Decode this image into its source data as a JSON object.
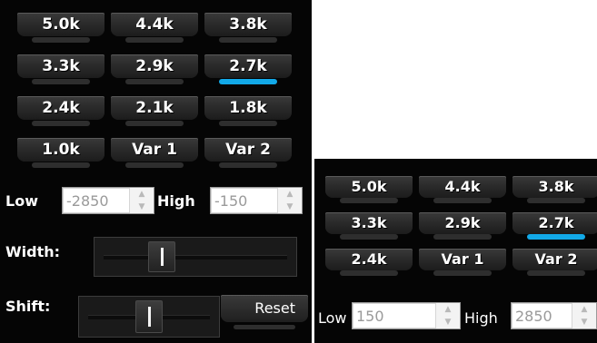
{
  "left": {
    "filters": [
      {
        "label": "5.0k",
        "active": false
      },
      {
        "label": "4.4k",
        "active": false
      },
      {
        "label": "3.8k",
        "active": false
      },
      {
        "label": "3.3k",
        "active": false
      },
      {
        "label": "2.9k",
        "active": false
      },
      {
        "label": "2.7k",
        "active": true
      },
      {
        "label": "2.4k",
        "active": false
      },
      {
        "label": "2.1k",
        "active": false
      },
      {
        "label": "1.8k",
        "active": false
      },
      {
        "label": "1.0k",
        "active": false
      },
      {
        "label": "Var 1",
        "active": false
      },
      {
        "label": "Var 2",
        "active": false
      }
    ],
    "low_label": "Low",
    "low_value": "-2850",
    "high_label": "High",
    "high_value": "-150",
    "width_label": "Width:",
    "width_position": 0.3,
    "shift_label": "Shift:",
    "shift_position": 0.5,
    "reset_label": "Reset"
  },
  "right": {
    "filters": [
      {
        "label": "5.0k",
        "active": false
      },
      {
        "label": "4.4k",
        "active": false
      },
      {
        "label": "3.8k",
        "active": false
      },
      {
        "label": "3.3k",
        "active": false
      },
      {
        "label": "2.9k",
        "active": false
      },
      {
        "label": "2.7k",
        "active": true
      },
      {
        "label": "2.4k",
        "active": false
      },
      {
        "label": "Var 1",
        "active": false
      },
      {
        "label": "Var 2",
        "active": false
      }
    ],
    "low_label": "Low",
    "low_value": "150",
    "high_label": "High",
    "high_value": "2850"
  },
  "colors": {
    "background": "#050505",
    "button_face": "#2b2b2b",
    "led_active": "#12a9e8",
    "led_inactive": "#2e2e2e",
    "text": "#ffffff"
  },
  "icons": {
    "spin_up": "up-arrow-icon",
    "spin_down": "down-arrow-icon"
  }
}
